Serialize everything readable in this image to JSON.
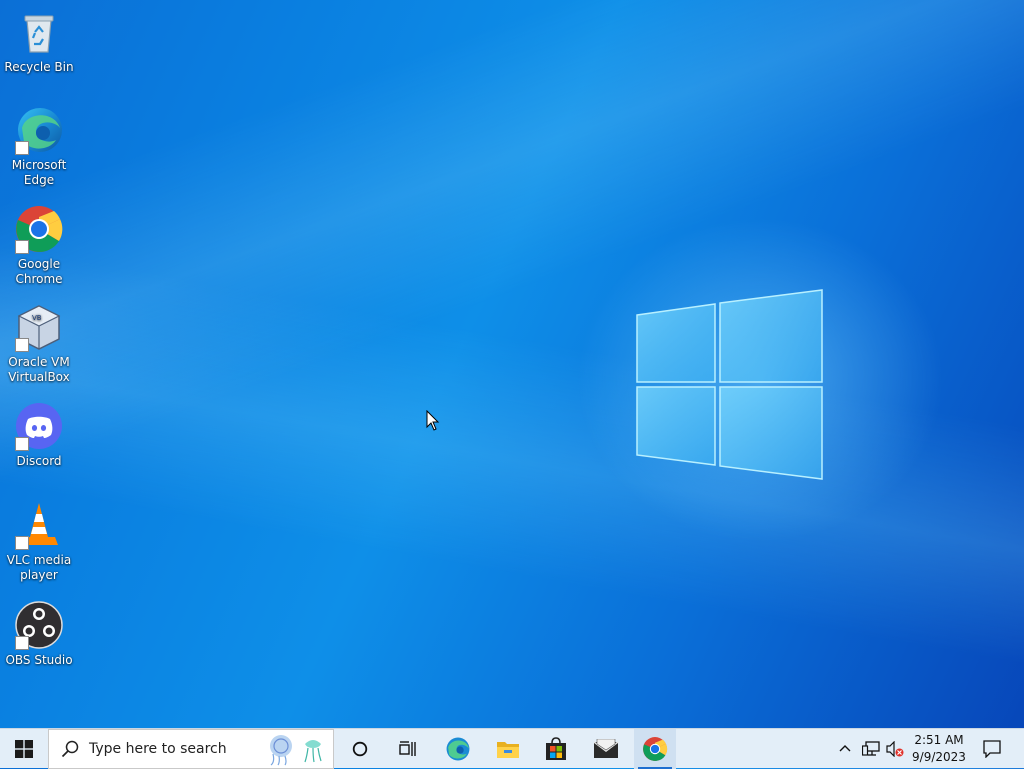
{
  "desktop": {
    "icons": [
      {
        "label": "Recycle Bin",
        "icon": "recycle-bin-icon"
      },
      {
        "label": "Microsoft\nEdge",
        "icon": "edge-icon"
      },
      {
        "label": "Google\nChrome",
        "icon": "chrome-icon"
      },
      {
        "label": "Oracle VM\nVirtualBox",
        "icon": "virtualbox-icon"
      },
      {
        "label": "Discord",
        "icon": "discord-icon"
      },
      {
        "label": "VLC media\nplayer",
        "icon": "vlc-icon"
      },
      {
        "label": "OBS Studio",
        "icon": "obs-icon"
      }
    ]
  },
  "taskbar": {
    "search_placeholder": "Type here to search",
    "pinned": [
      "start-icon",
      "cortana-icon",
      "task-view-icon",
      "edge-icon",
      "file-explorer-icon",
      "microsoft-store-icon",
      "mail-icon",
      "chrome-icon"
    ],
    "active_app": "chrome-icon",
    "tray": {
      "icons": [
        "show-hidden-icons-chevron",
        "network-icon",
        "volume-muted-icon",
        "notification-center-icon"
      ],
      "time": "2:51 AM",
      "date": "9/9/2023"
    }
  },
  "colors": {
    "accent": "#1f6fd0",
    "desktop_blue": "#0a7fe0",
    "taskbar": "#e3eef8"
  }
}
